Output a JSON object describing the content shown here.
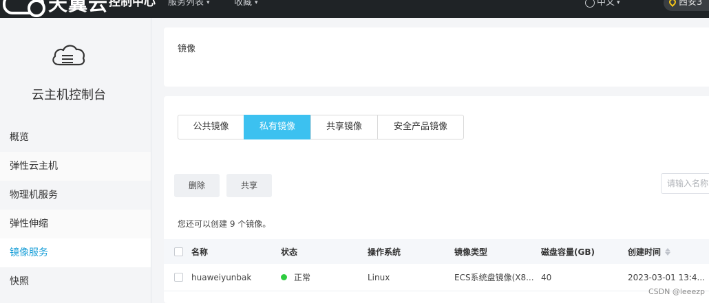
{
  "brand": {
    "logo_text": "天翼云",
    "console": "控制中心"
  },
  "topnav": {
    "services": "服务列表",
    "favorites": "收藏",
    "language": "中文",
    "region": "西安3"
  },
  "sidebar": {
    "title": "云主机控制台",
    "items": [
      {
        "label": "概览"
      },
      {
        "label": "弹性云主机"
      },
      {
        "label": "物理机服务"
      },
      {
        "label": "弹性伸缩"
      },
      {
        "label": "镜像服务"
      },
      {
        "label": "快照"
      }
    ],
    "active_index": 4
  },
  "page": {
    "title": "镜像"
  },
  "tabs": [
    {
      "label": "公共镜像"
    },
    {
      "label": "私有镜像"
    },
    {
      "label": "共享镜像"
    },
    {
      "label": "安全产品镜像"
    }
  ],
  "active_tab": 1,
  "toolbar": {
    "delete_label": "删除",
    "share_label": "共享",
    "search_placeholder": "请输入名称"
  },
  "quota_text": "您还可以创建 9 个镜像。",
  "table": {
    "headers": [
      "名称",
      "状态",
      "操作系统",
      "镜像类型",
      "磁盘容量(GB)",
      "创建时间"
    ],
    "rows": [
      {
        "name": "huaweiyunbak",
        "status": "正常",
        "os": "Linux",
        "type": "ECS系统盘镜像(X8...",
        "disk": "40",
        "created": "2023-03-01 13:4..."
      }
    ]
  },
  "watermark": "CSDN @leeezp",
  "colors": {
    "accent": "#3cc1f0",
    "link": "#1a9fd8",
    "status_ok": "#2ecc40",
    "topbar": "#1f2326"
  }
}
